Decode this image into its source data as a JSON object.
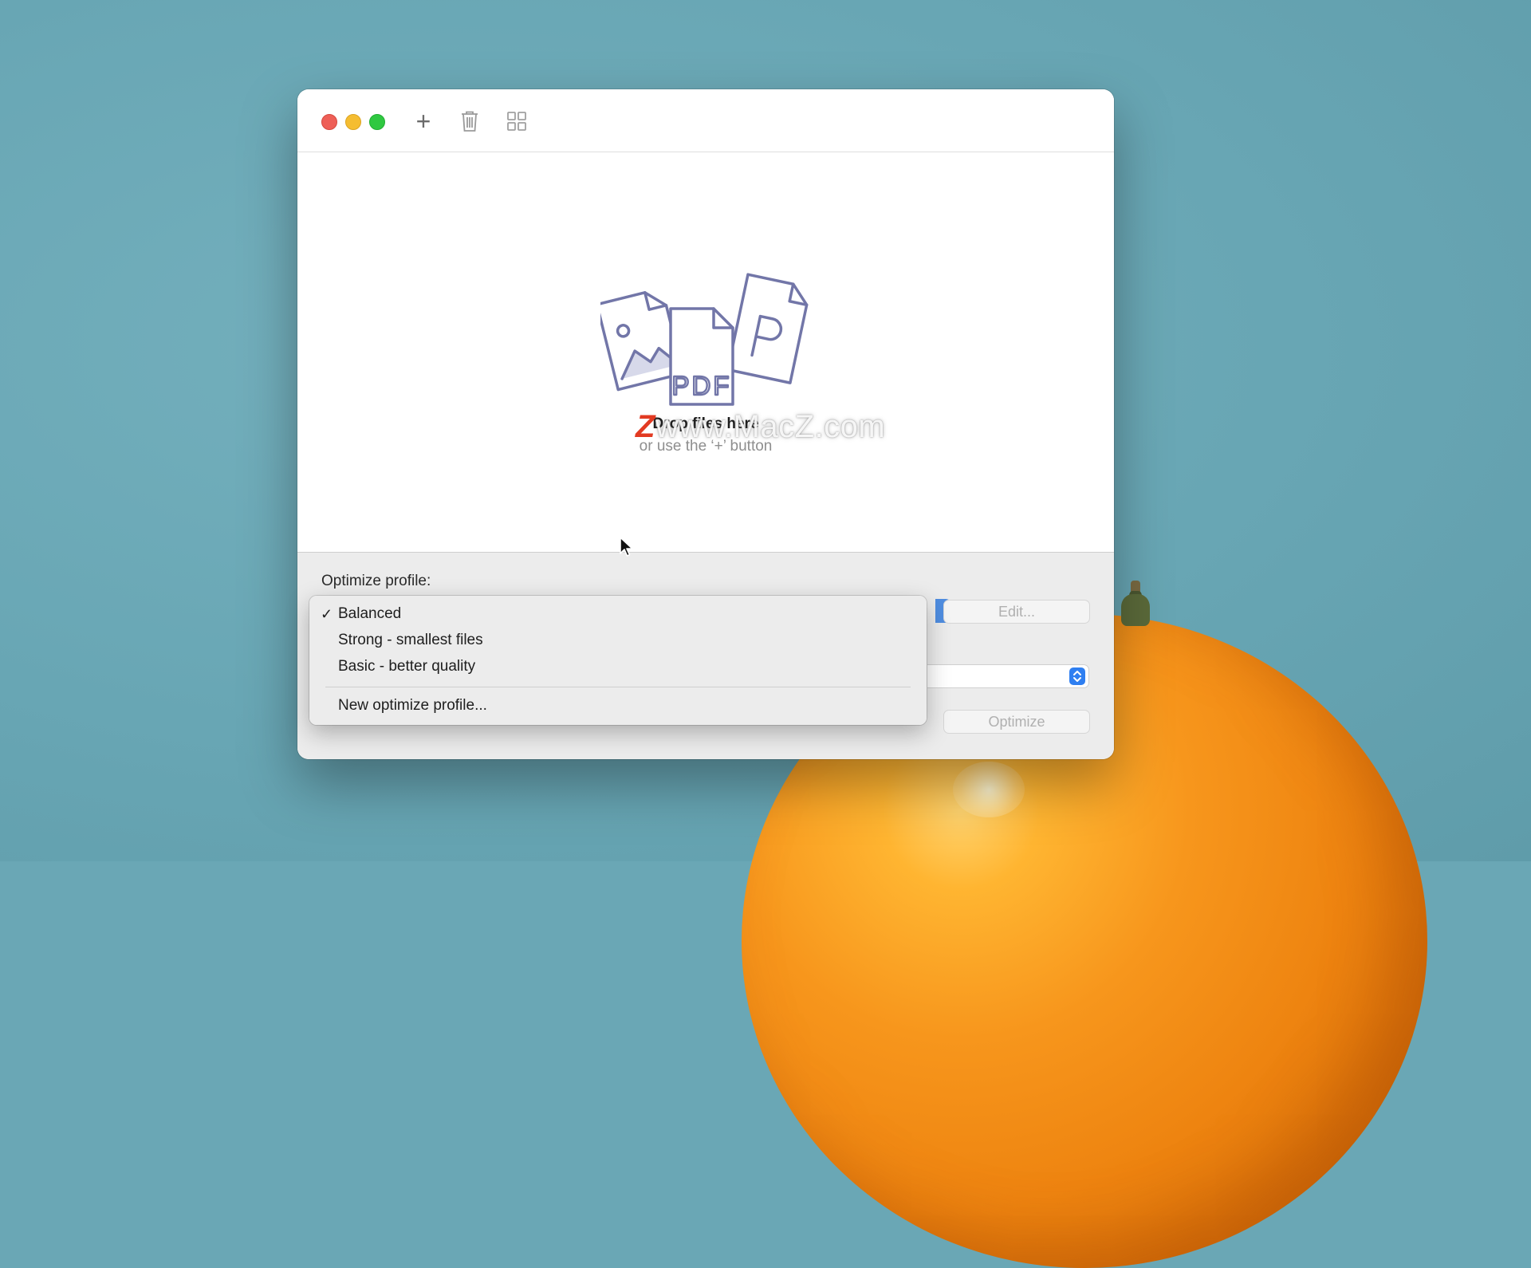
{
  "toolbar": {
    "add_icon": "+",
    "icons": [
      "plus-icon",
      "trash-icon",
      "grid-icon"
    ]
  },
  "dropzone": {
    "title": "Drop files here",
    "subtitle": "or use the ‘+’ button",
    "illustration_text": "PDF"
  },
  "watermark": {
    "logo": "Z",
    "text": "www.MacZ.com"
  },
  "settings": {
    "profile_label": "Optimize profile:",
    "edit_label": "Edit...",
    "optimize_label": "Optimize"
  },
  "menu": {
    "items": [
      {
        "label": "Balanced",
        "checked": true
      },
      {
        "label": "Strong - smallest files",
        "checked": false
      },
      {
        "label": "Basic - better quality",
        "checked": false
      }
    ],
    "new_profile": "New optimize profile...",
    "check_mark": "✓"
  },
  "colors": {
    "accent": "#2f7ff1",
    "illustration": "#7276a8",
    "close": "#ee5f57",
    "minimize": "#f5bd31",
    "maximize": "#2fc841"
  }
}
